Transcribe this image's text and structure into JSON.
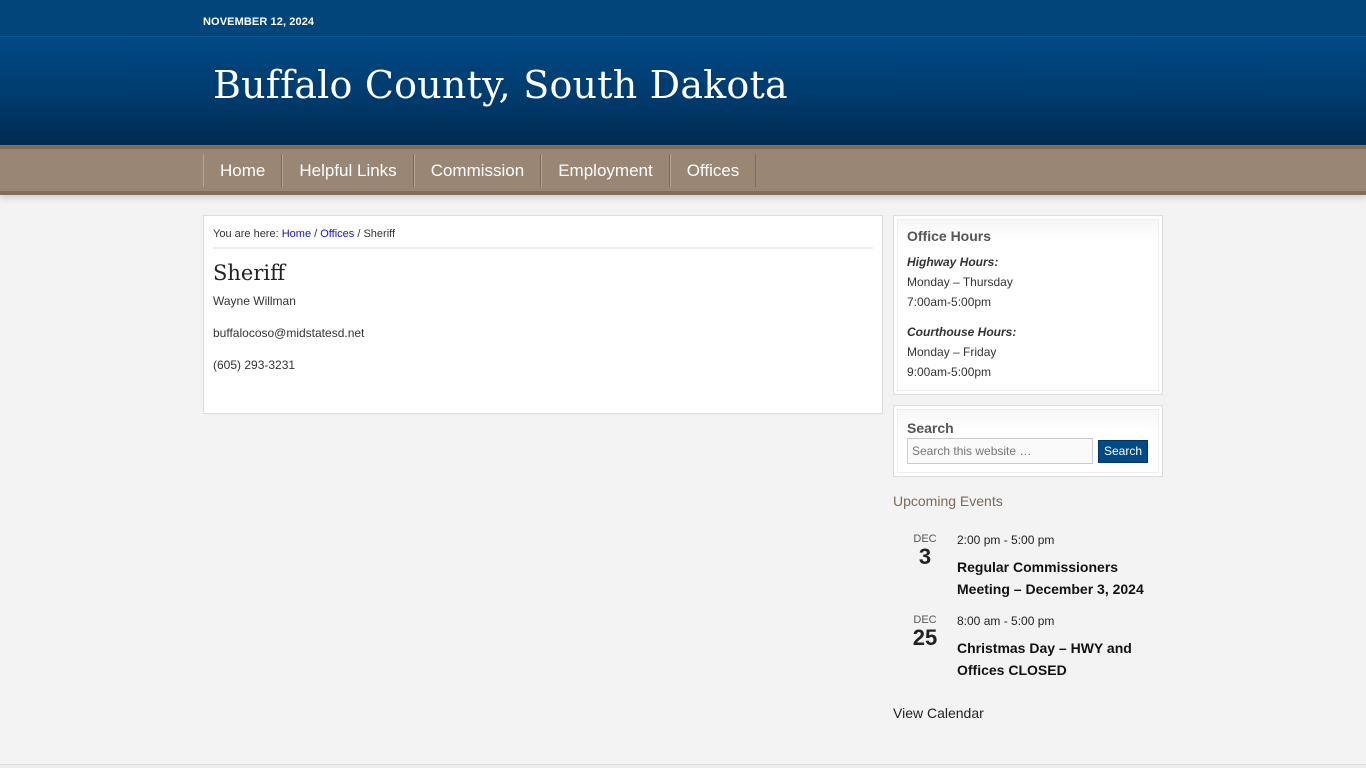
{
  "topbar": {
    "date": "NOVEMBER 12, 2024"
  },
  "header": {
    "site_title": "Buffalo County, South Dakota"
  },
  "nav": {
    "items": [
      {
        "label": "Home"
      },
      {
        "label": "Helpful Links"
      },
      {
        "label": "Commission"
      },
      {
        "label": "Employment"
      },
      {
        "label": "Offices"
      }
    ]
  },
  "breadcrumb": {
    "prefix": "You are here:",
    "home": "Home",
    "sep1": "/",
    "offices": "Offices",
    "sep2": "/",
    "current": "Sheriff"
  },
  "entry": {
    "title": "Sheriff",
    "name": "Wayne Willman",
    "email": "buffalocoso@midstatesd.net",
    "phone": "(605) 293-3231"
  },
  "office_hours": {
    "title": "Office Hours",
    "highway_label": "Highway Hours:",
    "highway_days": "Monday – Thursday",
    "highway_time": "7:00am-5:00pm",
    "courthouse_label": "Courthouse Hours:",
    "courthouse_days": "Monday – Friday",
    "courthouse_time": "9:00am-5:00pm"
  },
  "search": {
    "title": "Search",
    "placeholder": "Search this website …",
    "button": "Search"
  },
  "events": {
    "title": "Upcoming Events",
    "items": [
      {
        "month": "DEC",
        "day": "3",
        "time": "2:00 pm - 5:00 pm",
        "title": "Regular Commissioners Meeting – December 3, 2024"
      },
      {
        "month": "DEC",
        "day": "25",
        "time": "8:00 am - 5:00 pm",
        "title": "Christmas Day – HWY and Offices CLOSED"
      }
    ],
    "view_calendar": "View Calendar"
  }
}
